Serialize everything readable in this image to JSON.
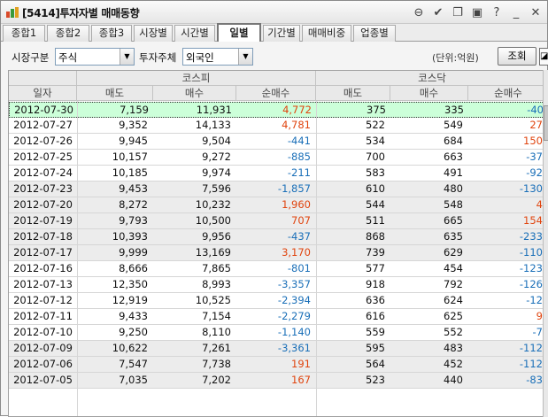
{
  "window": {
    "title": "[5414]투자자별 매매동향"
  },
  "toolbar_icons": [
    "link-icon",
    "check-icon",
    "copy-icon",
    "window-icon",
    "help-icon",
    "minimize-icon",
    "close-icon"
  ],
  "tabs": [
    {
      "label": "종합1",
      "active": false
    },
    {
      "label": "종합2",
      "active": false
    },
    {
      "label": "종합3",
      "active": false
    },
    {
      "label": "시장별",
      "active": false
    },
    {
      "label": "시간별",
      "active": false
    },
    {
      "label": "일별",
      "active": true
    },
    {
      "label": "기간별",
      "active": false
    },
    {
      "label": "매매비중",
      "active": false
    },
    {
      "label": "업종별",
      "active": false
    }
  ],
  "filters": {
    "market_label": "시장구분",
    "market_value": "주식",
    "investor_label": "투자주체",
    "investor_value": "외국인",
    "unit_text": "(단위:억원)",
    "search_button": "조회"
  },
  "table": {
    "group_headers": {
      "kospi": "코스피",
      "kosdaq": "코스닥"
    },
    "columns": [
      "일자",
      "매도",
      "매수",
      "순매수",
      "매도",
      "매수",
      "순매수"
    ],
    "rows": [
      [
        "2012-07-30",
        "7,159",
        "11,931",
        "4,772",
        "375",
        "335",
        "-40"
      ],
      [
        "2012-07-27",
        "9,352",
        "14,133",
        "4,781",
        "522",
        "549",
        "27"
      ],
      [
        "2012-07-26",
        "9,945",
        "9,504",
        "-441",
        "534",
        "684",
        "150"
      ],
      [
        "2012-07-25",
        "10,157",
        "9,272",
        "-885",
        "700",
        "663",
        "-37"
      ],
      [
        "2012-07-24",
        "10,185",
        "9,974",
        "-211",
        "583",
        "491",
        "-92"
      ],
      [
        "2012-07-23",
        "9,453",
        "7,596",
        "-1,857",
        "610",
        "480",
        "-130"
      ],
      [
        "2012-07-20",
        "8,272",
        "10,232",
        "1,960",
        "544",
        "548",
        "4"
      ],
      [
        "2012-07-19",
        "9,793",
        "10,500",
        "707",
        "511",
        "665",
        "154"
      ],
      [
        "2012-07-18",
        "10,393",
        "9,956",
        "-437",
        "868",
        "635",
        "-233"
      ],
      [
        "2012-07-17",
        "9,999",
        "13,169",
        "3,170",
        "739",
        "629",
        "-110"
      ],
      [
        "2012-07-16",
        "8,666",
        "7,865",
        "-801",
        "577",
        "454",
        "-123"
      ],
      [
        "2012-07-13",
        "12,350",
        "8,993",
        "-3,357",
        "918",
        "792",
        "-126"
      ],
      [
        "2012-07-12",
        "12,919",
        "10,525",
        "-2,394",
        "636",
        "624",
        "-12"
      ],
      [
        "2012-07-11",
        "9,433",
        "7,154",
        "-2,279",
        "616",
        "625",
        "9"
      ],
      [
        "2012-07-10",
        "9,250",
        "8,110",
        "-1,140",
        "559",
        "552",
        "-7"
      ],
      [
        "2012-07-09",
        "10,622",
        "7,261",
        "-3,361",
        "595",
        "483",
        "-112"
      ],
      [
        "2012-07-06",
        "7,547",
        "7,738",
        "191",
        "564",
        "452",
        "-112"
      ],
      [
        "2012-07-05",
        "7,035",
        "7,202",
        "167",
        "523",
        "440",
        "-83"
      ]
    ],
    "selected_row": 0,
    "colors": {
      "positive": "#e0440e",
      "negative": "#1a6fb8",
      "selected": "#ccffd9"
    }
  }
}
